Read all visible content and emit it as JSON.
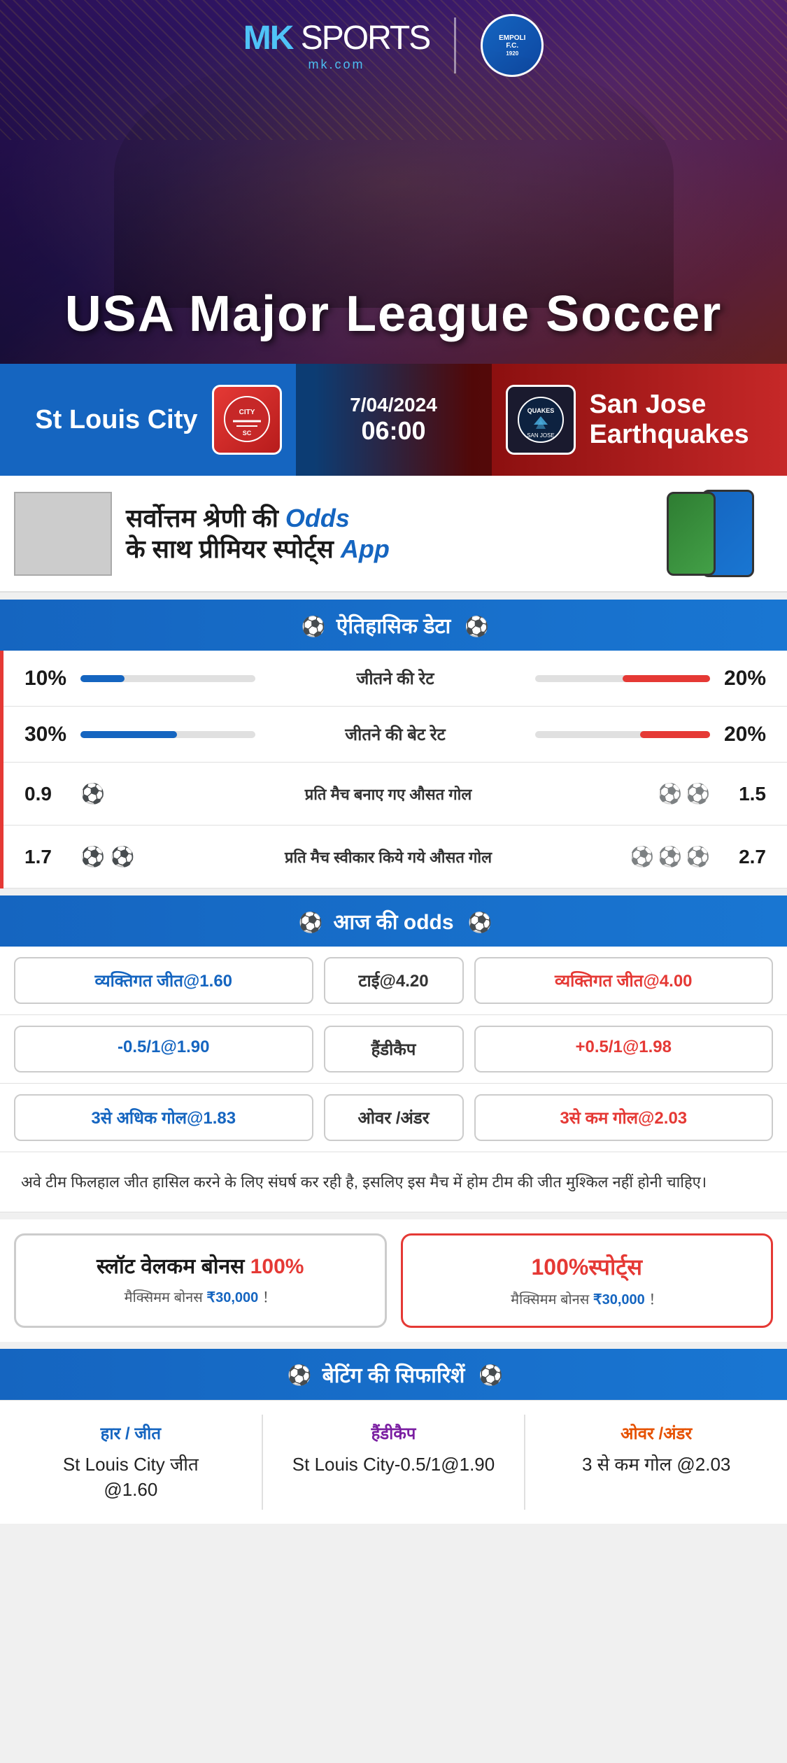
{
  "header": {
    "logo_mk": "MK",
    "logo_sports": "SPORTS",
    "logo_domain": "mk.com",
    "empoli_text": "EMPOLI F.C.\n1920",
    "hero_title": "USA Major League Soccer"
  },
  "match": {
    "home_team": "St Louis City",
    "away_team": "San Jose\nEarthquakes",
    "date": "7/04/2024",
    "time": "06:00",
    "home_logo": "CITY\nSC",
    "away_logo": "QUAKES"
  },
  "promo": {
    "main_text_line1": "सर्वोत्तम श्रेणी की",
    "main_text_bold": "Odds",
    "main_text_line2": "के साथ प्रीमियर स्पोर्ट्स",
    "main_text_app": "App"
  },
  "historical": {
    "section_title": "ऐतिहासिक डेटा",
    "stats": [
      {
        "label": "जीतने की रेट",
        "left_val": "10%",
        "right_val": "20%",
        "left_pct": 25,
        "right_pct": 50
      },
      {
        "label": "जीतने की बेट रेट",
        "left_val": "30%",
        "right_val": "20%",
        "left_pct": 55,
        "right_pct": 40
      }
    ],
    "goal_stats": [
      {
        "label": "प्रति मैच बनाए गए औसत गोल",
        "left_val": "0.9",
        "right_val": "1.5",
        "left_balls": 1,
        "right_balls": 2
      },
      {
        "label": "प्रति मैच स्वीकार किये गये औसत गोल",
        "left_val": "1.7",
        "right_val": "2.7",
        "left_balls": 2,
        "right_balls": 3
      }
    ]
  },
  "odds": {
    "section_title": "आज की odds",
    "rows": [
      {
        "left": "व्यक्तिगत जीत@1.60",
        "center": "टाई@4.20",
        "right": "व्यक्तिगत जीत@4.00",
        "center_label": "",
        "left_color": "blue",
        "right_color": "red"
      },
      {
        "left": "-0.5/1@1.90",
        "center": "हैंडीकैप",
        "right": "+0.5/1@1.98",
        "left_color": "blue",
        "right_color": "red"
      },
      {
        "left": "3से अधिक गोल@1.83",
        "center": "ओवर /अंडर",
        "right": "3से कम गोल@2.03",
        "left_color": "blue",
        "right_color": "red"
      }
    ]
  },
  "info_text": "अवे टीम फिलहाल जीत हासिल करने के लिए संघर्ष कर रही है, इसलिए इस मैच में होम टीम की जीत मुश्किल नहीं होनी चाहिए।",
  "bonus": {
    "left_title1": "स्लॉट वेलकम बोनस",
    "left_percent": "100%",
    "left_subtitle": "मैक्सिमम बोनस",
    "left_amount": "₹30,000",
    "left_exclaim": "！",
    "right_percent": "100%",
    "right_label": "स्पोर्ट्स",
    "right_subtitle": "मैक्सिमम बोनस",
    "right_amount": "₹30,000",
    "right_exclaim": "！"
  },
  "recommendations": {
    "section_title": "बेटिंग की सिफारिशें",
    "items": [
      {
        "title": "हार / जीत",
        "value": "St Louis City जीत\n@1.60",
        "color": "blue"
      },
      {
        "title": "हैंडीकैप",
        "value": "St Louis City-0.5/1@1.90",
        "color": "purple"
      },
      {
        "title": "ओवर /अंडर",
        "value": "3 से कम गोल @2.03",
        "color": "orange"
      }
    ]
  }
}
